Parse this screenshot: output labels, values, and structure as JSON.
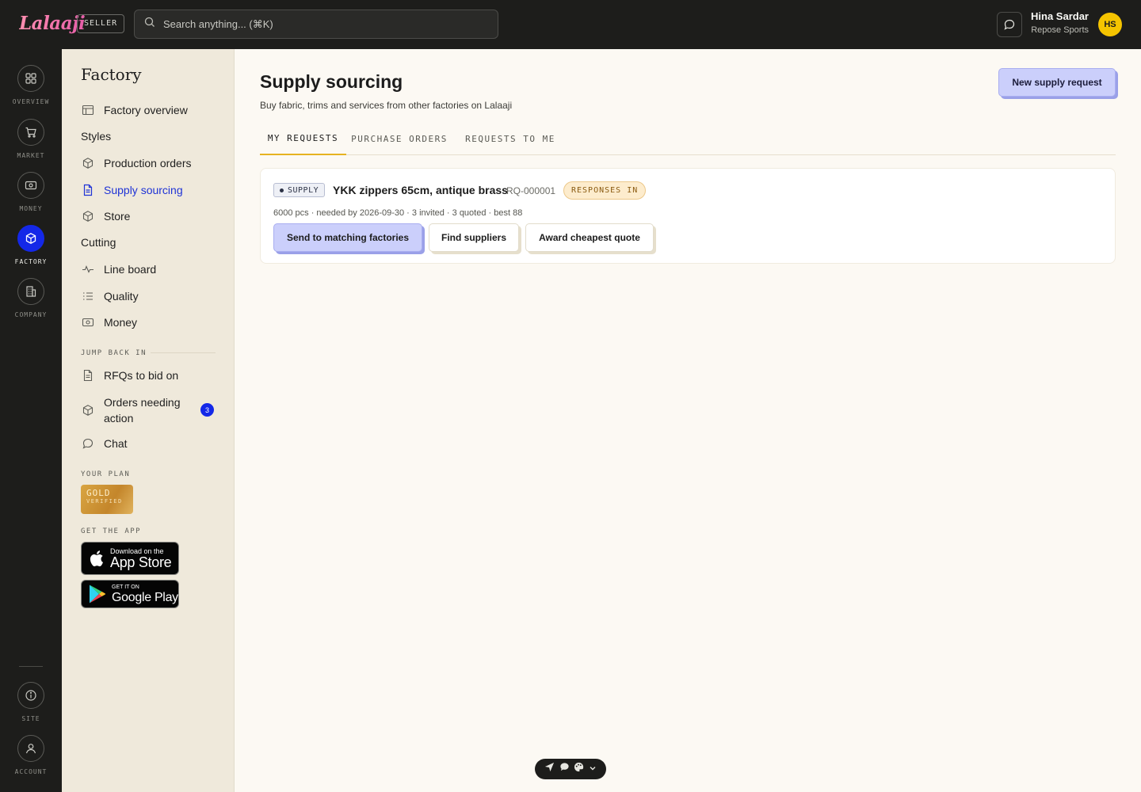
{
  "topbar": {
    "logo": "Lalaaji",
    "role_badge": "SELLER",
    "search_placeholder": "Search anything... (⌘K)",
    "user_name": "Hina Sardar",
    "user_org": "Repose Sports",
    "avatar_initials": "HS"
  },
  "rail": {
    "items": [
      {
        "label": "OVERVIEW",
        "icon": "grid-icon"
      },
      {
        "label": "MARKET",
        "icon": "cart-icon"
      },
      {
        "label": "MONEY",
        "icon": "cash-icon"
      },
      {
        "label": "FACTORY",
        "icon": "box-icon",
        "active": true
      },
      {
        "label": "COMPANY",
        "icon": "building-icon"
      }
    ],
    "bottom": [
      {
        "label": "SITE",
        "icon": "info-icon"
      },
      {
        "label": "ACCOUNT",
        "icon": "user-icon"
      }
    ]
  },
  "sidebar": {
    "title": "Factory",
    "factory_overview": "Factory overview",
    "styles": "Styles",
    "production_orders": "Production orders",
    "supply_sourcing": "Supply sourcing",
    "store": "Store",
    "cutting": "Cutting",
    "line_board": "Line board",
    "quality": "Quality",
    "money": "Money",
    "jump_back_in": "JUMP BACK IN",
    "rfqs": "RFQs to bid on",
    "orders_needing_1": "Orders needing",
    "orders_needing_2": "action",
    "orders_badge": "3",
    "chat": "Chat",
    "your_plan": "YOUR PLAN",
    "plan_name": "GOLD",
    "plan_status": "VERIFIED",
    "get_app": "GET THE APP",
    "appstore_small": "Download on the",
    "appstore_big": "App Store",
    "play_small": "GET IT ON",
    "play_big": "Google Play"
  },
  "main": {
    "title": "Supply sourcing",
    "subtitle": "Buy fabric, trims and services from other factories on Lalaaji",
    "new_button": "New supply request",
    "tabs": [
      "MY REQUESTS",
      "PURCHASE ORDERS",
      "REQUESTS TO ME"
    ],
    "request": {
      "tag": "SUPPLY",
      "title": "YKK zippers 65cm, antique brass",
      "id": "RQ-000001",
      "status": "RESPONSES IN",
      "meta": "6000 pcs · needed by 2026-09-30 · 3 invited · 3 quoted · best 88",
      "actions": [
        "Send to matching factories",
        "Find suppliers",
        "Award cheapest quote"
      ]
    }
  },
  "colors": {
    "accent_blue": "#1428e8",
    "primary_button": "#cbcffb",
    "tab_underline": "#e6b321",
    "avatar": "#f5c400"
  }
}
